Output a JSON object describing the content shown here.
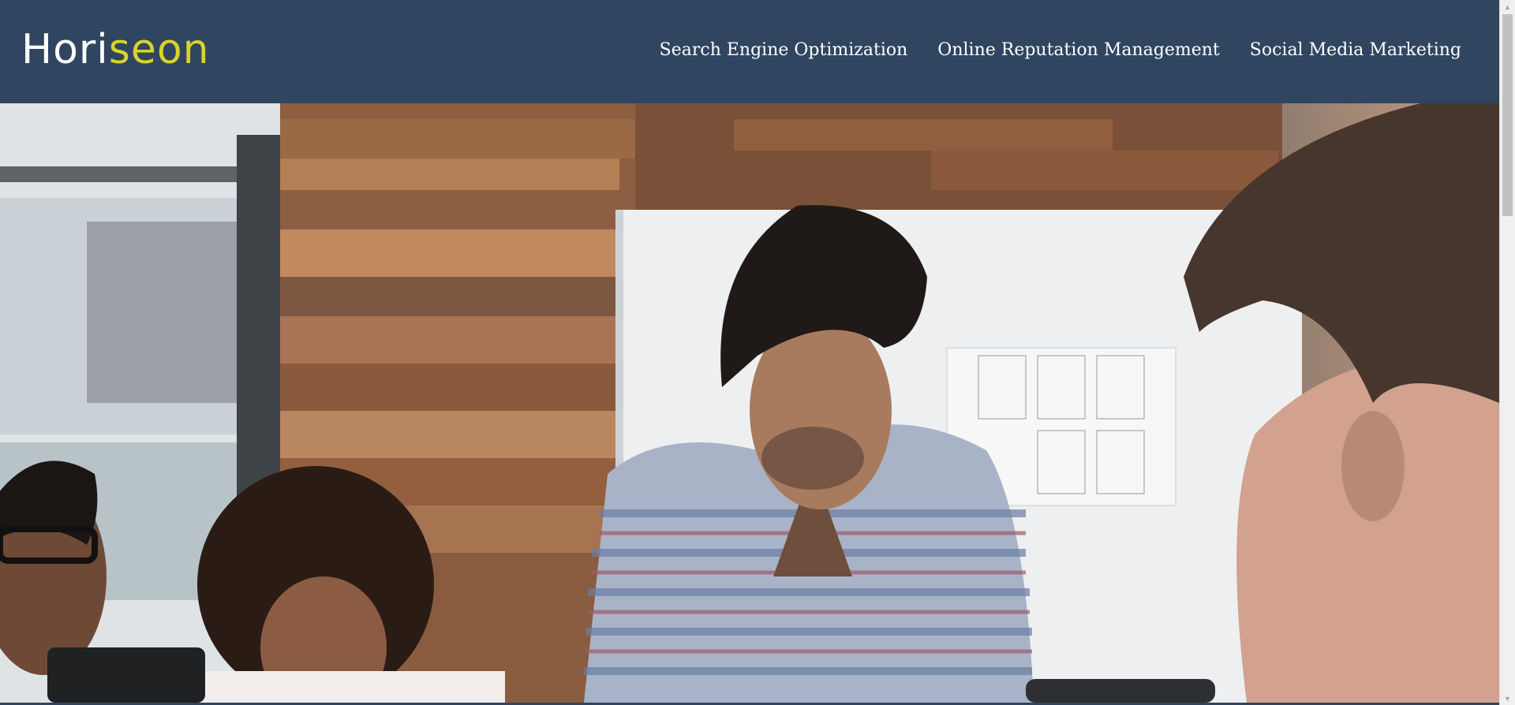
{
  "header": {
    "logo": {
      "part1": "Hori",
      "part2": "seon"
    },
    "nav": [
      {
        "label": "Search Engine Optimization"
      },
      {
        "label": "Online Reputation Management"
      },
      {
        "label": "Social Media Marketing"
      }
    ]
  },
  "hero": {
    "image_alt": "team meeting in office"
  },
  "colors": {
    "header_bg": "#2f4560",
    "logo_accent": "#d9d32a",
    "nav_text": "#ffffff"
  }
}
